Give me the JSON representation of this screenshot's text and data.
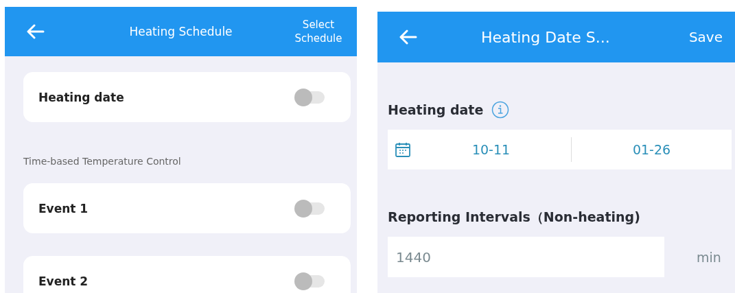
{
  "schedule_screen": {
    "header": {
      "title": "Heating Schedule",
      "action": "Select Schedule"
    },
    "heating_date": {
      "label": "Heating date",
      "on": false
    },
    "section_title": "Time-based Temperature Control",
    "events": [
      {
        "label": "Event 1",
        "on": false
      },
      {
        "label": "Event 2",
        "on": false
      }
    ]
  },
  "date_screen": {
    "header": {
      "title": "Heating Date S...",
      "action": "Save"
    },
    "heating_date_label": "Heating date",
    "date_range": {
      "start": "10-11",
      "end": "01-26"
    },
    "interval_label": "Reporting Intervals（Non-heating)",
    "interval_field": {
      "value": "1440",
      "unit": "min"
    }
  }
}
